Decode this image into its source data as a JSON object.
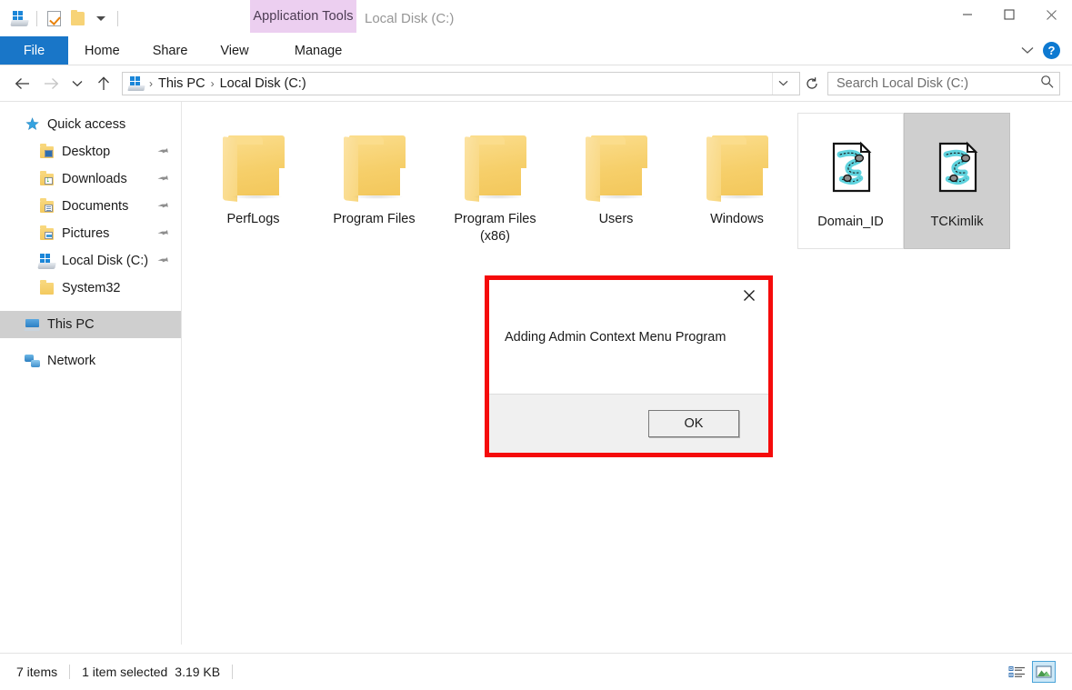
{
  "window": {
    "title": "Local Disk (C:)",
    "contextual_tab": "Application Tools",
    "minimize_icon": "minimize-icon",
    "maximize_icon": "maximize-icon",
    "close_icon": "close-icon"
  },
  "quick_access_toolbar": {
    "drive_icon": "drive-icon",
    "properties_icon": "properties-checkbox-icon",
    "new_folder_icon": "new-folder-icon",
    "customize_icon": "chevron-down-icon"
  },
  "ribbon": {
    "tabs": [
      {
        "label": "File",
        "active_file": true
      },
      {
        "label": "Home"
      },
      {
        "label": "Share"
      },
      {
        "label": "View"
      },
      {
        "label": "Manage",
        "contextual": true
      }
    ],
    "collapse_icon": "chevron-down-icon",
    "help_label": "?"
  },
  "address_bar": {
    "back_icon": "arrow-left-icon",
    "forward_icon": "arrow-right-icon",
    "recent_icon": "chevron-down-icon",
    "up_icon": "arrow-up-icon",
    "path_icon": "drive-icon",
    "crumbs": [
      "This PC",
      "Local Disk (C:)"
    ],
    "separator": "›",
    "dropdown_icon": "chevron-down-icon",
    "refresh_icon": "refresh-icon"
  },
  "search": {
    "placeholder": "Search Local Disk (C:)",
    "value": "",
    "icon": "search-icon"
  },
  "sidebar": {
    "items": [
      {
        "label": "Quick access",
        "icon": "star-icon",
        "indent": false,
        "pinned": false,
        "selected": false
      },
      {
        "label": "Desktop",
        "icon": "folder-desktop-icon",
        "indent": true,
        "pinned": true,
        "selected": false
      },
      {
        "label": "Downloads",
        "icon": "folder-downloads-icon",
        "indent": true,
        "pinned": true,
        "selected": false
      },
      {
        "label": "Documents",
        "icon": "folder-documents-icon",
        "indent": true,
        "pinned": true,
        "selected": false
      },
      {
        "label": "Pictures",
        "icon": "folder-pictures-icon",
        "indent": true,
        "pinned": true,
        "selected": false
      },
      {
        "label": "Local Disk (C:)",
        "icon": "drive-icon",
        "indent": true,
        "pinned": true,
        "selected": false
      },
      {
        "label": "System32",
        "icon": "folder-icon",
        "indent": true,
        "pinned": false,
        "selected": false
      },
      {
        "label": "This PC",
        "icon": "this-pc-icon",
        "indent": false,
        "pinned": false,
        "selected": true
      },
      {
        "label": "Network",
        "icon": "network-icon",
        "indent": false,
        "pinned": false,
        "selected": false
      }
    ],
    "pin_glyph": "📌"
  },
  "files": [
    {
      "name": "PerfLogs",
      "type": "folder",
      "state": "normal"
    },
    {
      "name": "Program Files",
      "type": "folder",
      "state": "normal"
    },
    {
      "name": "Program Files (x86)",
      "type": "folder",
      "state": "normal"
    },
    {
      "name": "Users",
      "type": "folder",
      "state": "normal"
    },
    {
      "name": "Windows",
      "type": "folder",
      "state": "normal"
    },
    {
      "name": "Domain_ID",
      "type": "vbscript",
      "state": "hovered"
    },
    {
      "name": "TCKimlik",
      "type": "vbscript",
      "state": "selected"
    }
  ],
  "dialog": {
    "message": "Adding Admin Context Menu Program",
    "ok_label": "OK",
    "close_icon": "close-icon",
    "highlight_color": "#f50b0b"
  },
  "status_bar": {
    "item_count": "7 items",
    "selection": "1 item selected",
    "size": "3.19 KB",
    "details_view_icon": "details-view-icon",
    "large_icons_view_icon": "large-icons-view-icon"
  },
  "colors": {
    "file_tab_blue": "#1976c8",
    "contextual_purple": "#eccff0",
    "selection_gray": "#cfcfcf",
    "annotation_red": "#f50b0b",
    "folder_yellow": "#f6cf6a"
  }
}
